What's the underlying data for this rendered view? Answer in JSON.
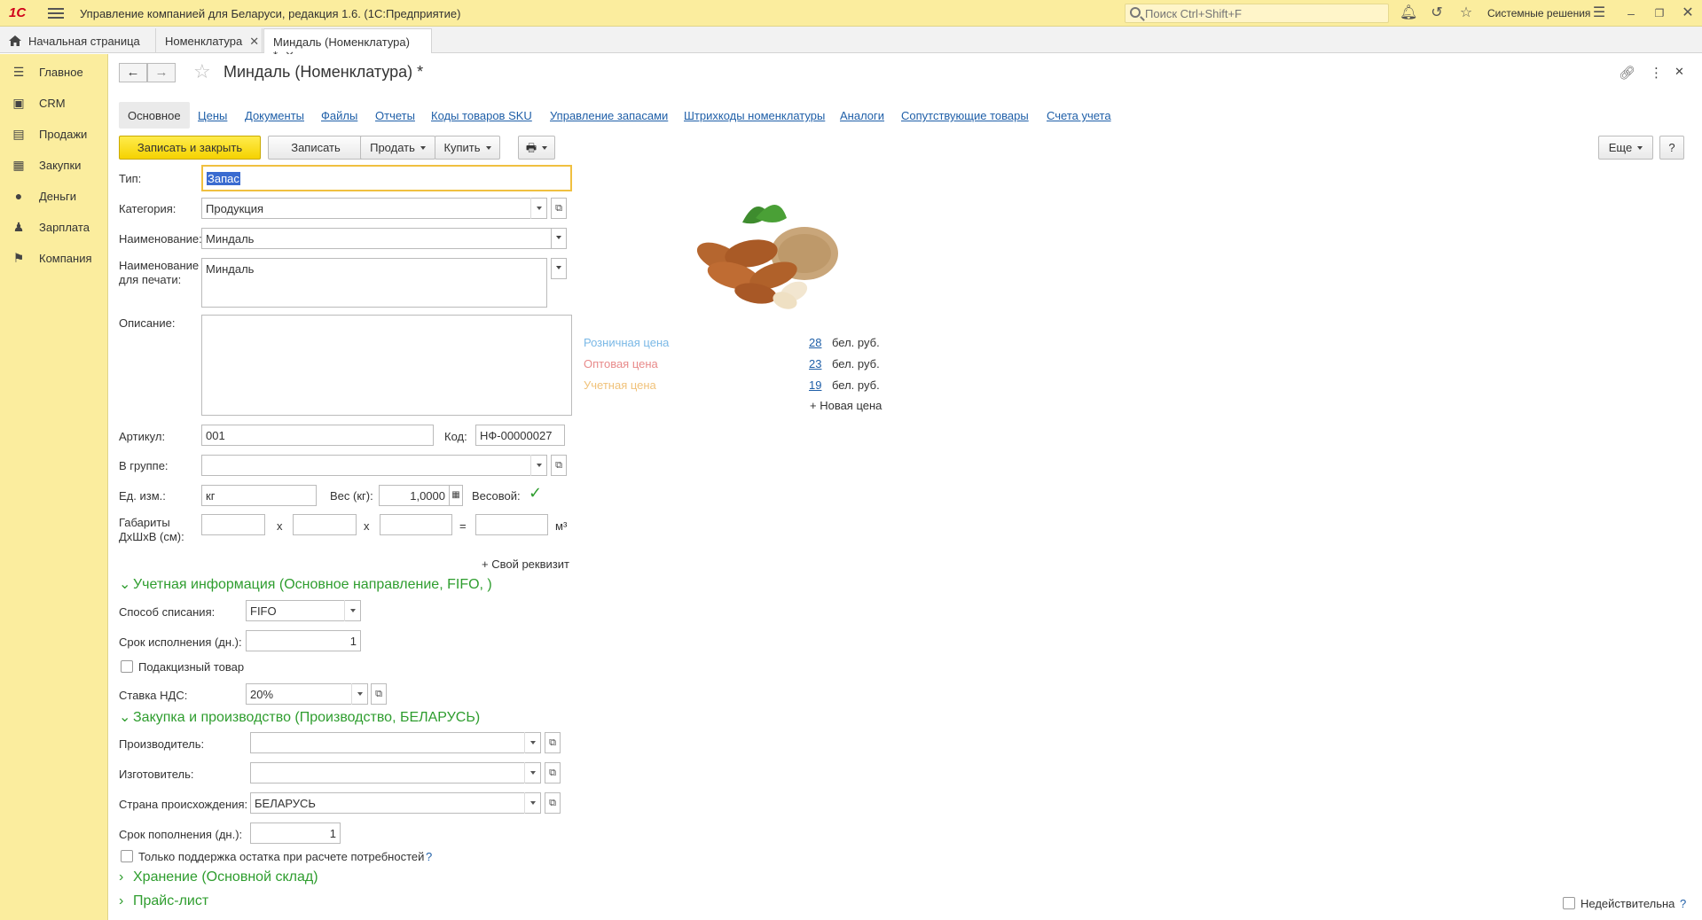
{
  "app": {
    "title": "Управление компанией для Беларуси, редакция 1.6.   (1С:Предприятие)",
    "search_placeholder": "Поиск Ctrl+Shift+F",
    "system_solutions": "Системные решения"
  },
  "tabs": [
    {
      "label": "Начальная страница"
    },
    {
      "label": "Номенклатура"
    },
    {
      "label": "Миндаль (Номенклатура) *"
    }
  ],
  "sidebar": {
    "items": [
      {
        "label": "Главное",
        "icon": "menu-icon"
      },
      {
        "label": "CRM",
        "icon": "crm-icon"
      },
      {
        "label": "Продажи",
        "icon": "sales-icon"
      },
      {
        "label": "Закупки",
        "icon": "purchases-icon"
      },
      {
        "label": "Деньги",
        "icon": "money-icon"
      },
      {
        "label": "Зарплата",
        "icon": "salary-icon"
      },
      {
        "label": "Компания",
        "icon": "company-icon"
      }
    ]
  },
  "doc": {
    "title": "Миндаль (Номенклатура) *"
  },
  "section_tabs": [
    "Основное",
    "Цены",
    "Документы",
    "Файлы",
    "Отчеты",
    "Коды товаров SKU",
    "Управление запасами",
    "Штрихкоды номенклатуры",
    "Аналоги",
    "Сопутствующие товары",
    "Счета учета"
  ],
  "toolbar": {
    "save_close": "Записать и закрыть",
    "save": "Записать",
    "sell": "Продать",
    "buy": "Купить",
    "more": "Еще",
    "help": "?"
  },
  "form": {
    "type_label": "Тип:",
    "type_value": "Запас",
    "category_label": "Категория:",
    "category_value": "Продукция",
    "name_label": "Наименование:",
    "name_value": "Миндаль",
    "print_name_label": "Наименование для печати:",
    "print_name_value": "Миндаль",
    "description_label": "Описание:",
    "article_label": "Артикул:",
    "article_value": "001",
    "code_label": "Код:",
    "code_value": "НФ-00000027",
    "group_label": "В группе:",
    "unit_label": "Ед. изм.:",
    "unit_value": "кг",
    "weight_label": "Вес (кг):",
    "weight_value": "1,0000",
    "weighted_label": "Весовой:",
    "dims_label": "Габариты ДхШхВ (см):",
    "dims_x": "x",
    "dims_eq": "=",
    "dims_unit": "м³",
    "custom_attr": "+ Свой реквизит"
  },
  "accounting": {
    "head": "Учетная информация (Основное направление, FIFO, )",
    "writeoff_label": "Способ списания:",
    "writeoff_value": "FIFO",
    "exec_term_label": "Срок исполнения (дн.):",
    "exec_term_value": "1",
    "excise_label": "Подакцизный товар",
    "vat_label": "Ставка НДС:",
    "vat_value": "20%"
  },
  "purchase": {
    "head": "Закупка и производство (Производство, БЕЛАРУСЬ)",
    "producer_label": "Производитель:",
    "maker_label": "Изготовитель:",
    "country_label": "Страна происхождения:",
    "country_value": "БЕЛАРУСЬ",
    "replenish_label": "Срок пополнения (дн.):",
    "replenish_value": "1",
    "only_support_label": "Только поддержка остатка при расчете потребностей",
    "only_support_hint": "?"
  },
  "storage": {
    "head": "Хранение (Основной склад)"
  },
  "pricelist": {
    "head": "Прайс-лист"
  },
  "inactive": {
    "label": "Недействительна",
    "hint": "?"
  },
  "prices": [
    {
      "label": "Розничная цена",
      "value": "28",
      "currency": "бел. руб.",
      "color": "#7ab8e6"
    },
    {
      "label": "Оптовая цена",
      "value": "23",
      "currency": "бел. руб.",
      "color": "#e88a8a"
    },
    {
      "label": "Учетная цена",
      "value": "19",
      "currency": "бел. руб.",
      "color": "#f0c27a"
    }
  ],
  "new_price": "+ Новая цена",
  "colors": {
    "accent_yellow": "#fbed9e",
    "primary_button": "#f5d200",
    "section_green": "#2e9d2e",
    "link_blue": "#1f5fa8"
  }
}
